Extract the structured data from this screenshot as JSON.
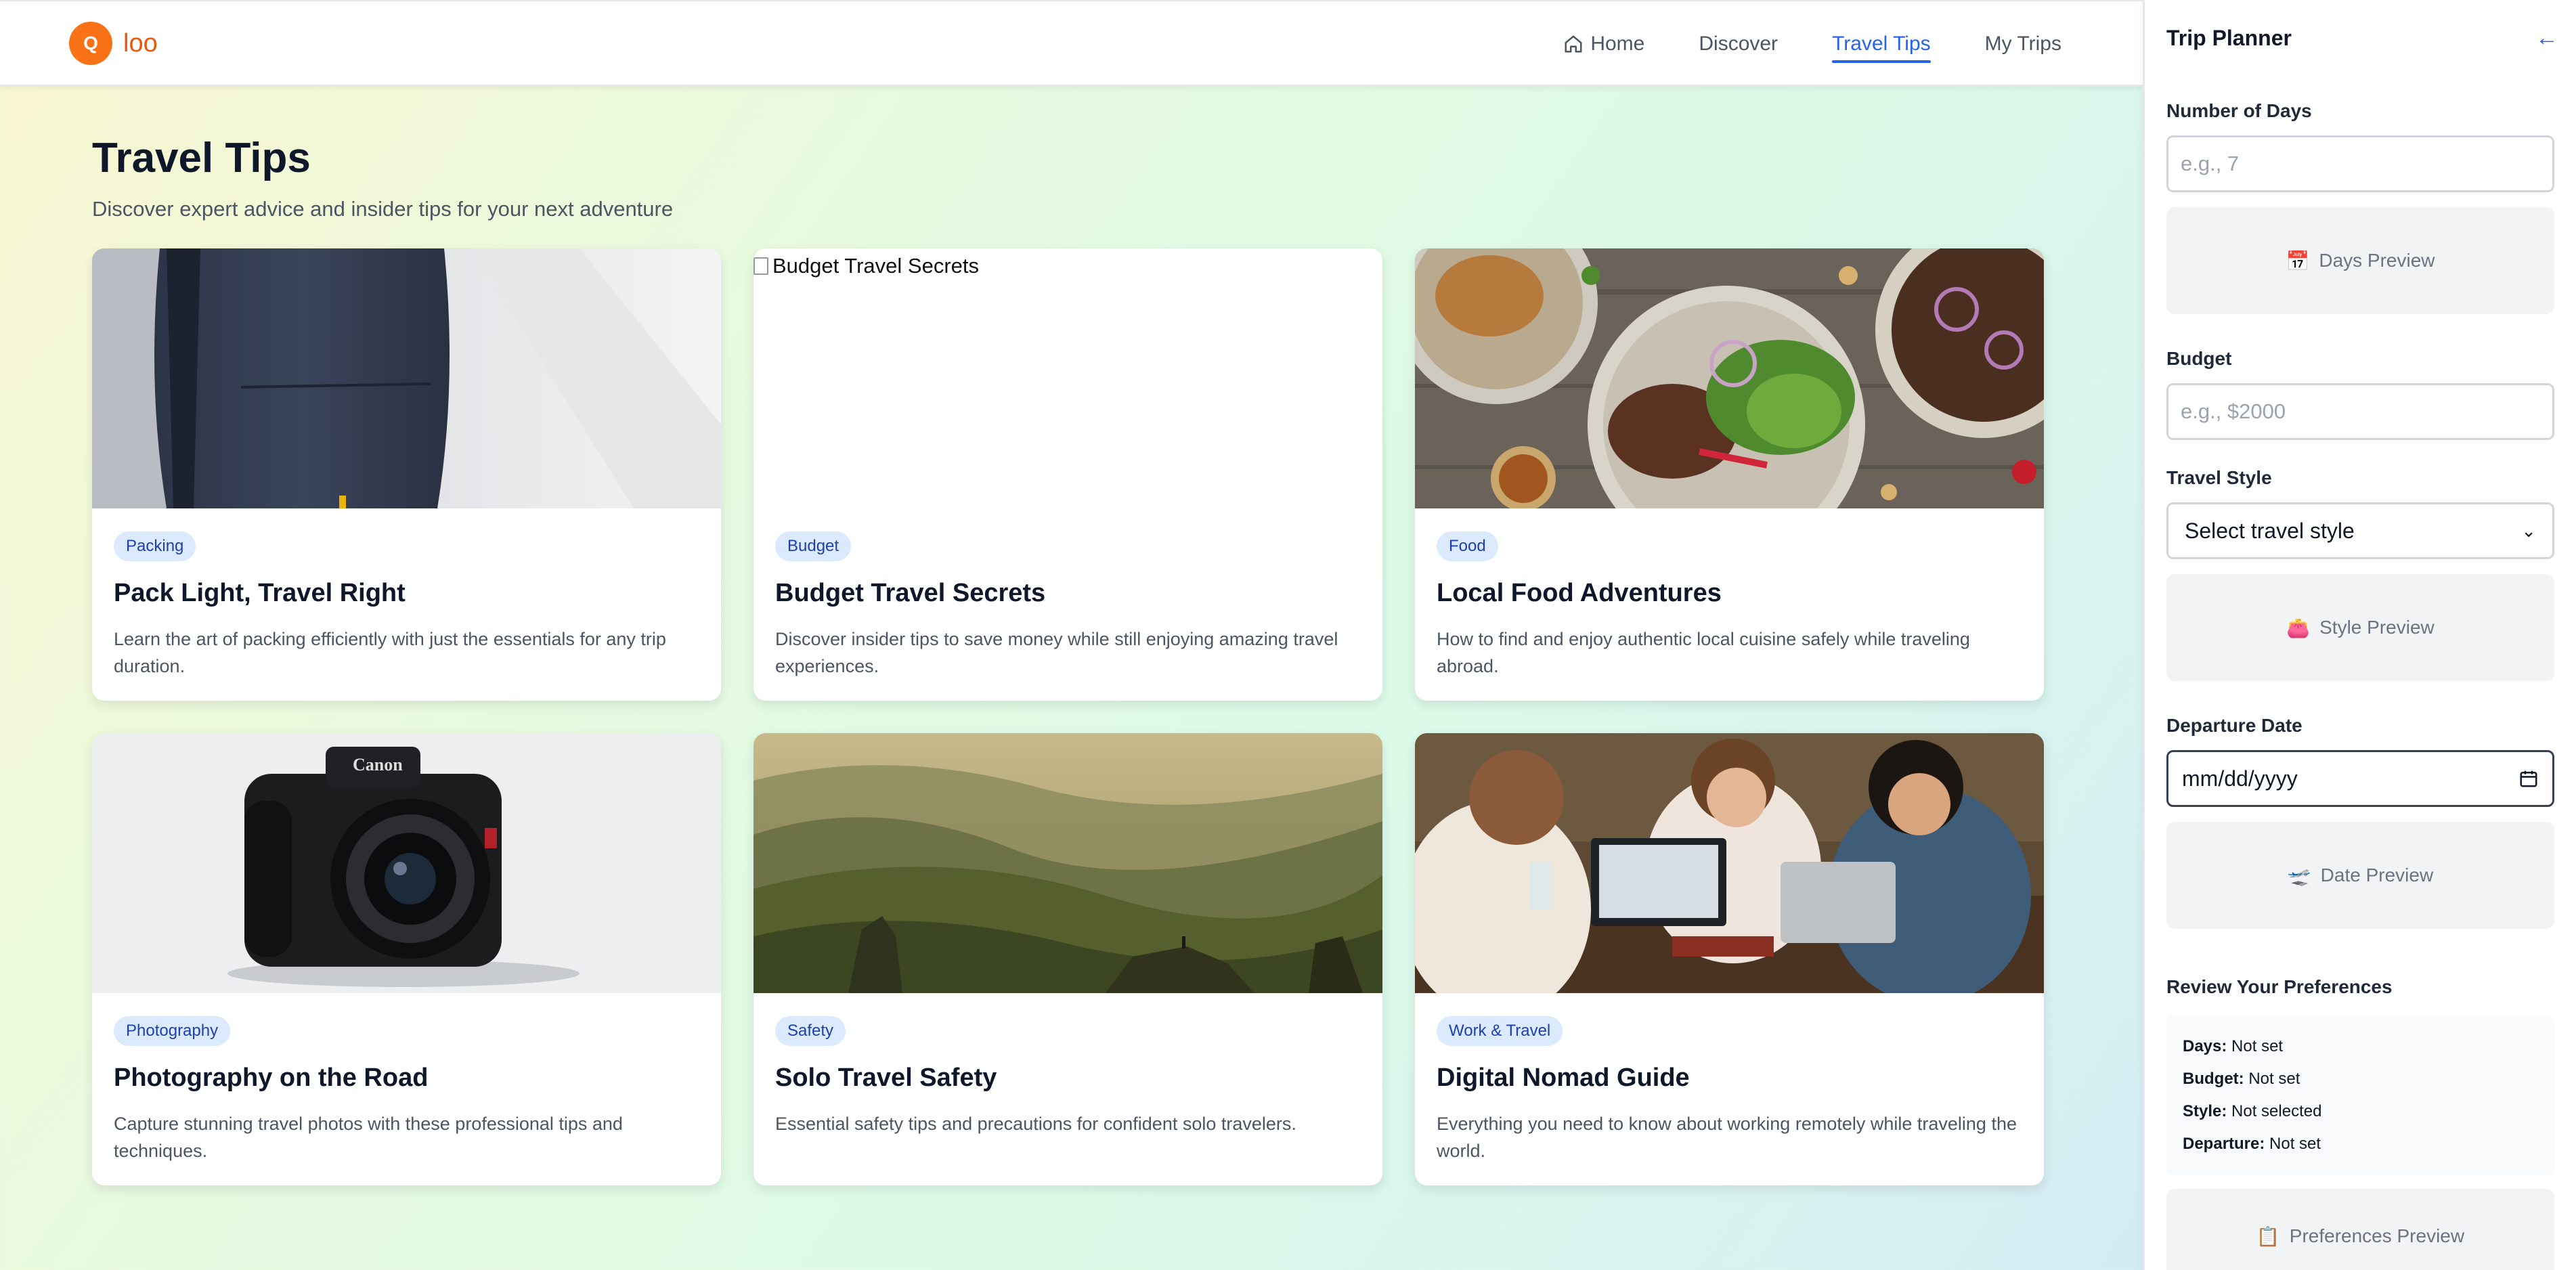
{
  "brand": {
    "logo_letter": "Q",
    "name": "loo"
  },
  "nav": {
    "items": [
      {
        "label": "Home",
        "icon": "home-icon"
      },
      {
        "label": "Discover"
      },
      {
        "label": "Travel Tips",
        "active": true
      },
      {
        "label": "My Trips"
      }
    ]
  },
  "main": {
    "title": "Travel Tips",
    "subtitle": "Discover expert advice and insider tips for your next adventure",
    "cards": [
      {
        "tag": "Packing",
        "title": "Pack Light, Travel Right",
        "desc": "Learn the art of packing efficiently with just the essentials for any trip duration."
      },
      {
        "tag": "Budget",
        "title": "Budget Travel Secrets",
        "desc": "Discover insider tips to save money while still enjoying amazing travel experiences.",
        "image_alt": "Budget Travel Secrets"
      },
      {
        "tag": "Food",
        "title": "Local Food Adventures",
        "desc": "How to find and enjoy authentic local cuisine safely while traveling abroad."
      },
      {
        "tag": "Photography",
        "title": "Photography on the Road",
        "desc": "Capture stunning travel photos with these professional tips and techniques."
      },
      {
        "tag": "Safety",
        "title": "Solo Travel Safety",
        "desc": "Essential safety tips and precautions for confident solo travelers."
      },
      {
        "tag": "Work & Travel",
        "title": "Digital Nomad Guide",
        "desc": "Everything you need to know about working remotely while traveling the world."
      }
    ]
  },
  "sidebar": {
    "title": "Trip Planner",
    "back_icon": "←",
    "days": {
      "label": "Number of Days",
      "placeholder": "e.g., 7",
      "preview": "Days Preview",
      "preview_icon": "📅"
    },
    "budget": {
      "label": "Budget",
      "placeholder": "e.g., $2000"
    },
    "style": {
      "label": "Travel Style",
      "selected": "Select travel style",
      "preview": "Style Preview",
      "preview_icon": "👛"
    },
    "departure": {
      "label": "Departure Date",
      "value": "mm/dd/yyyy",
      "preview": "Date Preview",
      "preview_icon": "🛫"
    },
    "review": {
      "title": "Review Your Preferences",
      "rows": [
        {
          "key": "Days:",
          "value": "Not set"
        },
        {
          "key": "Budget:",
          "value": "Not set"
        },
        {
          "key": "Style:",
          "value": "Not selected"
        },
        {
          "key": "Departure:",
          "value": "Not set"
        }
      ],
      "preview": "Preferences Preview",
      "preview_icon": "📋"
    }
  },
  "colors": {
    "accent": "#2563eb",
    "brand": "#f97316",
    "tag_bg": "#dbeafe",
    "tag_text": "#1e40af"
  }
}
